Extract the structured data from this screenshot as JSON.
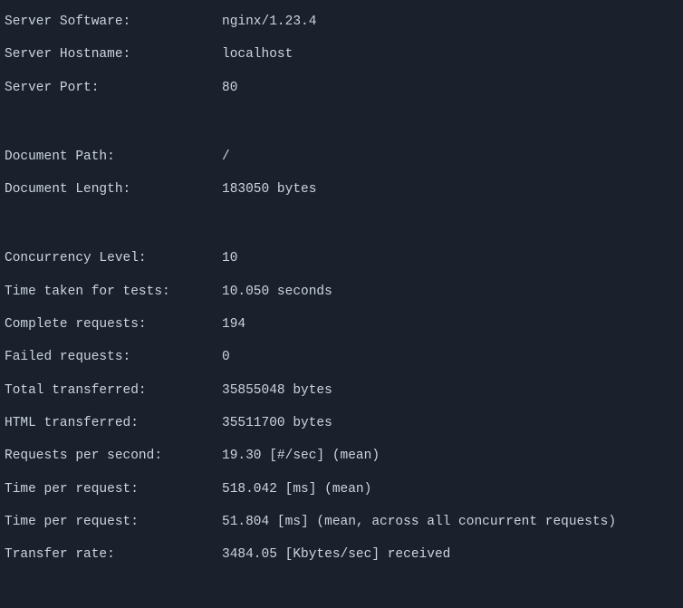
{
  "server_software": {
    "label": "Server Software:",
    "value": "nginx/1.23.4"
  },
  "server_hostname": {
    "label": "Server Hostname:",
    "value": "localhost"
  },
  "server_port": {
    "label": "Server Port:",
    "value": "80"
  },
  "document_path": {
    "label": "Document Path:",
    "value": "/"
  },
  "document_length": {
    "label": "Document Length:",
    "value": "183050 bytes"
  },
  "concurrency_level": {
    "label": "Concurrency Level:",
    "value": "10"
  },
  "time_taken": {
    "label": "Time taken for tests:",
    "value": "10.050 seconds"
  },
  "complete_requests": {
    "label": "Complete requests:",
    "value": "194"
  },
  "failed_requests": {
    "label": "Failed requests:",
    "value": "0"
  },
  "total_transferred": {
    "label": "Total transferred:",
    "value": "35855048 bytes"
  },
  "html_transferred": {
    "label": "HTML transferred:",
    "value": "35511700 bytes"
  },
  "requests_per_second": {
    "label": "Requests per second:",
    "value": "19.30 [#/sec] (mean)"
  },
  "time_per_request_1": {
    "label": "Time per request:",
    "value": "518.042 [ms] (mean)"
  },
  "time_per_request_2": {
    "label": "Time per request:",
    "value": "51.804 [ms] (mean, across all concurrent requests)"
  },
  "transfer_rate": {
    "label": "Transfer rate:",
    "value": "3484.05 [Kbytes/sec] received"
  }
}
